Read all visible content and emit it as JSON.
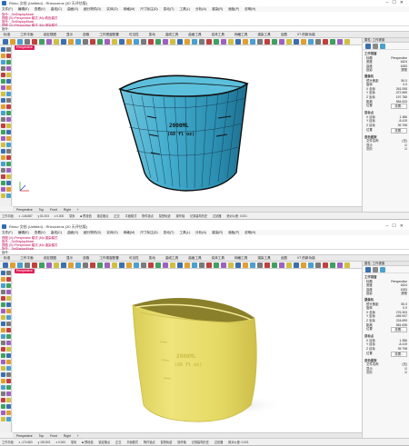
{
  "windows": [
    {
      "title": "Rhino 文档 (Untitled) - Rhinoceros (30 天评估版)",
      "menu": [
        "文件(F)",
        "编辑(E)",
        "查看(V)",
        "曲线(C)",
        "曲面(S)",
        "细分物件(D)",
        "实体(O)",
        "网格(M)",
        "尺寸标注(D)",
        "变动(T)",
        "工具(L)",
        "分析(A)",
        "渲染(R)",
        "面板(P)",
        "说明(H)"
      ],
      "command_history": [
        "指令: _SetDisplayMode",
        "视图 (V)=Perspective 模式 (M)=着色模式",
        "指令: _SetDisplayMode",
        "视图 (V)=Perspective 模式 (M)=渲染模式",
        "指令: _SetDisplayMode"
      ],
      "command_prompt": "指令:",
      "toolbar_tabs": [
        "标准",
        "工作平面",
        "设定视图",
        "显示",
        "选取",
        "工作视窗配置",
        "可见性",
        "变动",
        "曲线工具",
        "曲面工具",
        "实体工具",
        "网格工具",
        "渲染工具",
        "出图",
        "V7 的新功能"
      ],
      "viewport_label": "Perspective",
      "view_tabs": [
        "Perspective",
        "Top",
        "Front",
        "Right",
        "+"
      ],
      "status": [
        "工作平面",
        "x -146.887",
        "y 51.003",
        "z 0.000",
        "毫米",
        "■ 预设值",
        "锁定格点",
        "正交",
        "平面模式",
        "物件锁点",
        "智慧轨迹",
        "操作轴",
        "记录建构历史",
        "过滤器",
        "绝对公差: 0.001"
      ],
      "model_text": [
        "2000ML",
        "(68 fl oz)"
      ],
      "render_mode": "wireframe-shaded"
    },
    {
      "title": "Rhino 文档 (Untitled) - Rhinoceros (30 天评估版)",
      "menu": [
        "文件(F)",
        "编辑(E)",
        "查看(V)",
        "曲线(C)",
        "曲面(S)",
        "细分物件(D)",
        "实体(O)",
        "网格(M)",
        "尺寸标注(D)",
        "变动(T)",
        "工具(L)",
        "分析(A)",
        "渲染(R)",
        "面板(P)",
        "说明(H)"
      ],
      "command_history": [
        "视图 (V)=Perspective 模式 (M)=渲染模式",
        "指令: _SetDisplayMode",
        "视图 (V)=Perspective 模式 (M)=渲染模式",
        "指令: _SetDisplayMode",
        "视图 (V)=Perspective 模式 (M)=渲染模式"
      ],
      "command_prompt": "指令:",
      "toolbar_tabs": [
        "标准",
        "工作平面",
        "设定视图",
        "显示",
        "选取",
        "工作视窗配置",
        "可见性",
        "变动",
        "曲线工具",
        "曲面工具",
        "实体工具",
        "网格工具",
        "渲染工具",
        "出图",
        "V7 的新功能"
      ],
      "viewport_label": "Perspective",
      "view_tabs": [
        "Perspective",
        "Top",
        "Front",
        "Right",
        "+"
      ],
      "status": [
        "工作平面",
        "x -174.583",
        "y 192.801",
        "z 0.000",
        "毫米",
        "■ 预设值",
        "锁定格点",
        "正交",
        "平面模式",
        "物件锁点",
        "智慧轨迹",
        "操作轴",
        "记录建构历史",
        "过滤器",
        "绝对公差: 0.001"
      ],
      "model_text": [
        "2000ML",
        "(68 fl oz)"
      ],
      "render_mode": "rendered"
    }
  ],
  "properties_panels": [
    {
      "title": "属性: 工作视窗",
      "sections": [
        {
          "heading": "工作视窗",
          "rows": [
            [
              "标题",
              "Perspective"
            ],
            [
              "宽度",
              "1624"
            ],
            [
              "高度",
              "1083"
            ],
            [
              "投影",
              "透视"
            ]
          ]
        },
        {
          "heading": "摄像机",
          "rows": [
            [
              "镜头焦距",
              "50.0"
            ],
            [
              "旋转",
              "0.0"
            ],
            [
              "X 坐标",
              "261.095"
            ],
            [
              "Y 坐标",
              "-372.559"
            ],
            [
              "Z 坐标",
              "197.785"
            ],
            [
              "距离",
              "584.633"
            ],
            [
              "位置",
              "放置..."
            ]
          ]
        },
        {
          "heading": "目标点",
          "rows": [
            [
              "X 目标",
              "1.386"
            ],
            [
              "Y 目标",
              "-8.419"
            ],
            [
              "Z 目标",
              "39.798"
            ],
            [
              "位置",
              "放置..."
            ]
          ]
        },
        {
          "heading": "底色图案",
          "rows": [
            [
              "文件名称",
              "(无)"
            ],
            [
              "显示",
              "☑"
            ],
            [
              "灰阶",
              "☑"
            ]
          ]
        }
      ]
    },
    {
      "title": "属性: 工作视窗",
      "sections": [
        {
          "heading": "工作视窗",
          "rows": [
            [
              "标题",
              "Perspective"
            ],
            [
              "宽度",
              "1624"
            ],
            [
              "高度",
              "1083"
            ],
            [
              "投影",
              "透视"
            ]
          ]
        },
        {
          "heading": "摄像机",
          "rows": [
            [
              "镜头焦距",
              "50.0"
            ],
            [
              "旋转",
              "0.0"
            ],
            [
              "X 坐标",
              "276.303"
            ],
            [
              "Y 坐标",
              "-455.937"
            ],
            [
              "Z 坐标",
              "224.699"
            ],
            [
              "距离",
              "581.635"
            ],
            [
              "位置",
              "放置..."
            ]
          ]
        },
        {
          "heading": "目标点",
          "rows": [
            [
              "X 目标",
              "1.386"
            ],
            [
              "Y 目标",
              "-8.419"
            ],
            [
              "Z 目标",
              "39.798"
            ],
            [
              "位置",
              "放置..."
            ]
          ]
        },
        {
          "heading": "底色图案",
          "rows": [
            [
              "文件名称",
              "(无)"
            ],
            [
              "显示",
              "☑"
            ],
            [
              "灰阶",
              "☑"
            ]
          ]
        }
      ]
    }
  ],
  "colors": {
    "viewport_label_bg": "#e0205a",
    "model_blue": "#3aa7c9",
    "model_yellow": "#ece173",
    "history_text": "#c00050"
  }
}
